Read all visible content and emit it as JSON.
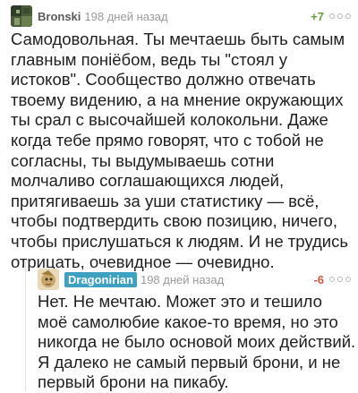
{
  "comments": [
    {
      "author": "Bronski",
      "time": "198 дней назад",
      "rating": "+7",
      "text": "Самодовольная. Ты мечтаешь быть самым главным понiёбом, ведь ты \"стоял у истоков\". Сообщество должно отвечать твоему видению, а на мнение окружающих ты срал с высочайшей колокольни. Даже когда тебе прямо говорят, что с тобой не согласны, ты выдумываешь сотни молчаливо соглашающихся людей, притягиваешь за уши статистику — всё, чтобы подтвердить свою позицию, ничего, чтобы прислушаться к людям. И не трудись отрицать, очевидное — очевидно."
    },
    {
      "author": "Dragoniriаn",
      "time": "198 дней назад",
      "rating": "-6",
      "text": "Нет. Не мечтаю. Может это и тешило моё самолюбие какое-то время, но это никогда не было основой моих действий. Я далеко не самый первый брони, и не первый брони на пикабу."
    }
  ],
  "colors": {
    "positive_rating": "#6a9d3a",
    "negative_rating": "#d0543f",
    "badge": "#3ea1c2"
  }
}
